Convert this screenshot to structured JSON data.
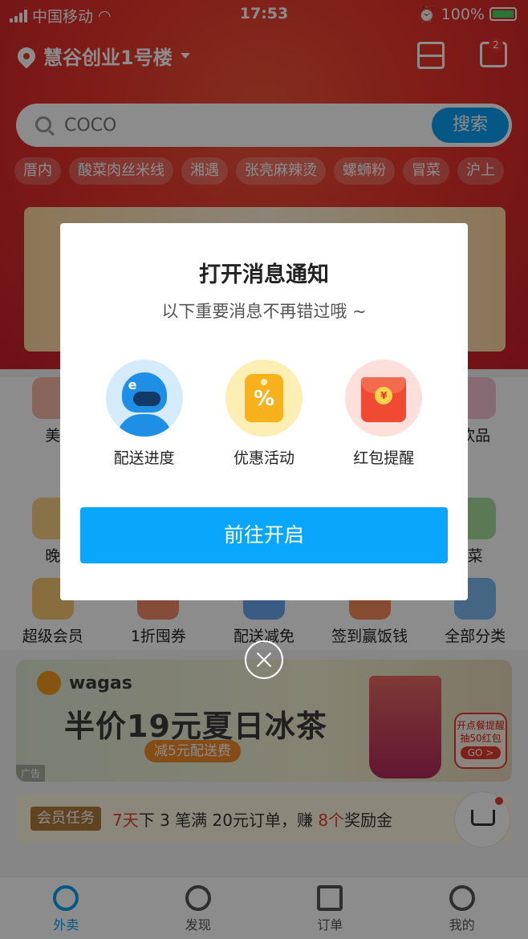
{
  "status_bar": {
    "carrier": "中国移动",
    "time": "17:53",
    "battery": "100%"
  },
  "header": {
    "location": "慧谷创业1号楼",
    "message_badge": "2"
  },
  "search": {
    "placeholder": "COCO",
    "button": "搜索"
  },
  "hot_tags": [
    "厝内",
    "酸菜肉丝米线",
    "湘遇",
    "张亮麻辣烫",
    "螺蛳粉",
    "冒菜",
    "沪上"
  ],
  "categories": {
    "row1": [
      "美",
      "",
      "",
      "",
      "饮品"
    ],
    "row2": [
      "晚",
      "",
      "",
      "",
      "菜"
    ],
    "row3": [
      "超级会员",
      "1折囤券",
      "配送减免",
      "签到赢饭钱",
      "全部分类"
    ]
  },
  "ad": {
    "brand": "wagas",
    "title": "半价19元夏日冰茶",
    "subtitle": "减5元配送费",
    "tag": "广告",
    "side_line1": "开点餐提醒",
    "side_line2": "抽50红包",
    "side_go": "GO >"
  },
  "task": {
    "badge": "会员任务",
    "part1": "7天",
    "part2": "下 3 笔满 20元订单，赚 ",
    "part3": "8个",
    "part4": "奖励金"
  },
  "tabbar": {
    "tabs": [
      "外卖",
      "发现",
      "订单",
      "我的"
    ]
  },
  "dialog": {
    "title": "打开消息通知",
    "subtitle": "以下重要消息不再错过哦 ~",
    "features": [
      "配送进度",
      "优惠活动",
      "红包提醒"
    ],
    "button": "前往开启",
    "coin_symbol": "¥",
    "coupon_symbol": "%"
  },
  "colors": {
    "accent": "#0aa6fb",
    "hero_red": "#e8352a"
  }
}
